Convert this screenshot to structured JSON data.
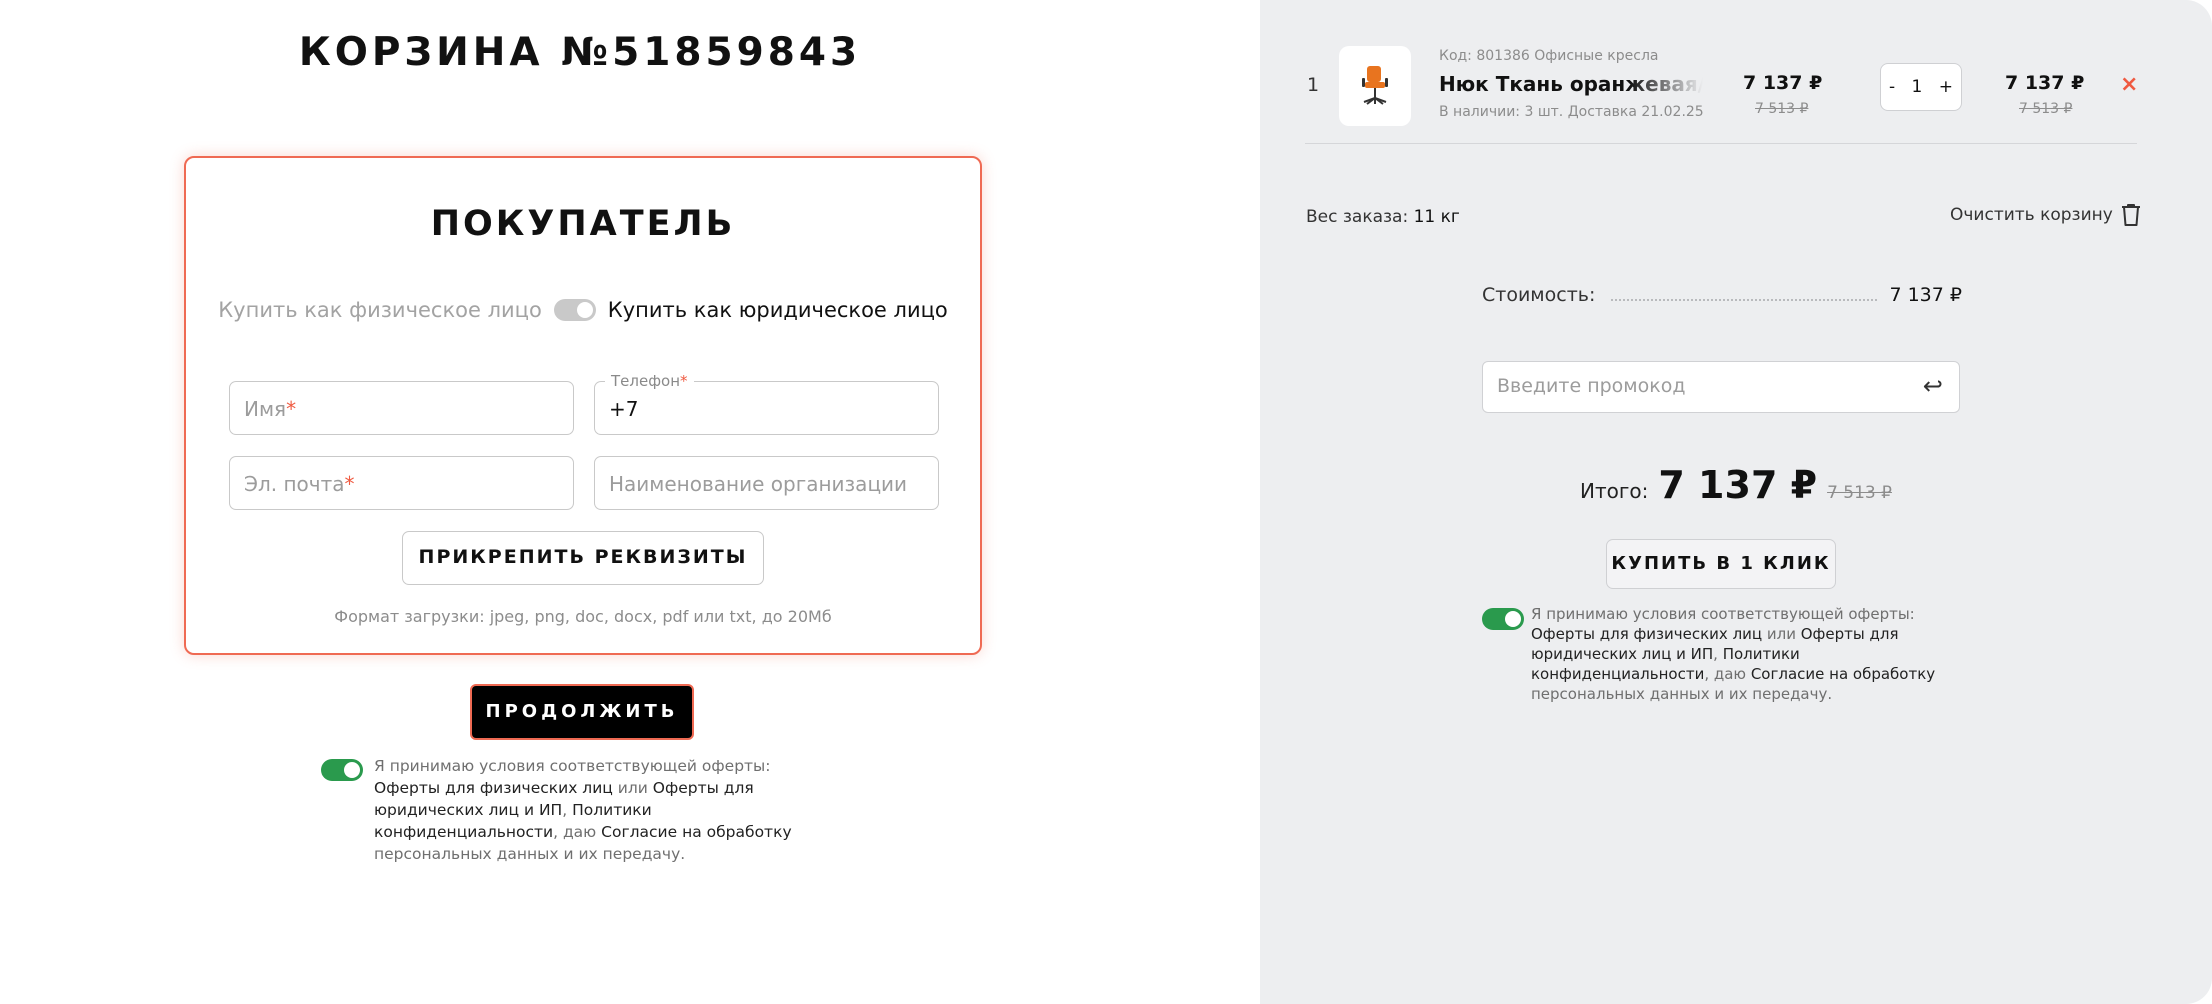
{
  "cart": {
    "title": "КОРЗИНА №51859843"
  },
  "buyer": {
    "title": "ПОКУПАТЕЛЬ",
    "type_physical": "Купить как физическое лицо",
    "type_legal": "Купить как юридическое лицо",
    "name_placeholder": "Имя",
    "phone_label": "Телефон",
    "phone_value": "+7",
    "email_placeholder": "Эл. почта",
    "org_placeholder": "Наименование организации",
    "required_mark": "*",
    "attach_label": "ПРИКРЕПИТЬ РЕКВИЗИТЫ",
    "upload_hint": "Формат загрузки: jpeg, png, doc, docx, pdf или txt, до 20Мб",
    "continue_label": "ПРОДОЛЖИТЬ"
  },
  "consent_left": {
    "t1": "Я принимаю условия соответствующей оферты: ",
    "l1": "Оферты для физических лиц",
    "t2": "  или ",
    "l2": "Оферты для юридических лиц и ИП",
    "t3": ", ",
    "l3": "Политики конфиденциальности",
    "t4": ", даю ",
    "l4": "Согласие на обработку",
    "t5": " персональных данных и их передачу."
  },
  "item": {
    "index": "1",
    "code": "Код: 801386 Офисные кресла",
    "name": "Нюк Ткань оранжевая/Сетка",
    "stock": "В наличии: 3 шт. Доставка 21.02.25",
    "price": "7 137 ₽",
    "price_old": "7 513 ₽",
    "qty_minus": "-",
    "qty": "1",
    "qty_plus": "+",
    "sum": "7 137 ₽",
    "sum_old": "7 513 ₽",
    "remove": "×"
  },
  "summary": {
    "weight_label": "Вес заказа: ",
    "weight_value": "11 кг",
    "clear_label": "Очистить корзину",
    "cost_label": "Стоимость:",
    "cost_value": "7 137 ₽",
    "promo_placeholder": "Введите промокод",
    "total_label": "Итого:",
    "total_value": "7 137 ₽",
    "total_old": "7 513 ₽",
    "buy_one_click": "КУПИТЬ В 1 КЛИК"
  },
  "consent_right": {
    "t1": "Я принимаю условия соответствующей оферты: ",
    "l1": "Оферты для физических лиц",
    "t2": " или ",
    "l2": "Оферты для юридических лиц и ИП",
    "t3": ", ",
    "l3": "Политики конфиденциальности",
    "t4": ", даю ",
    "l4": "Согласие на обработку",
    "t5": " персональных данных и их передачу."
  },
  "colors": {
    "accent": "#ef5a41",
    "toggle_on": "#2a9a4d",
    "panel_bg": "#edeef0"
  },
  "icons": {
    "trash": "trash-icon",
    "enter": "enter-icon",
    "chair": "office-chair-icon"
  }
}
